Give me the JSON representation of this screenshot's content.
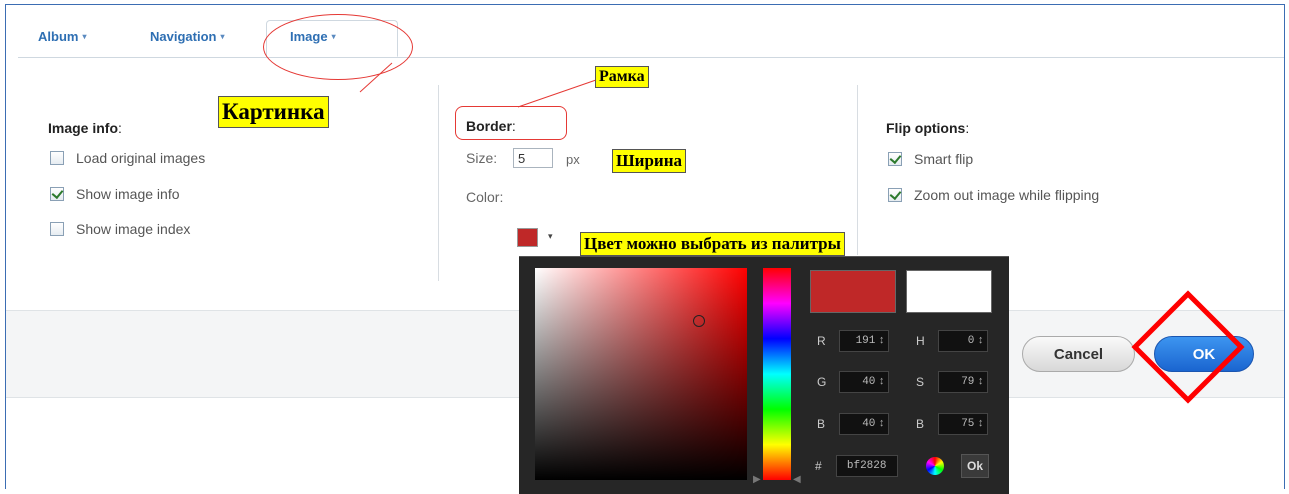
{
  "tabs": [
    {
      "label": "Album"
    },
    {
      "label": "Navigation"
    },
    {
      "label": "Image"
    }
  ],
  "image_info": {
    "title": "Image info",
    "options": [
      {
        "label": "Load original images",
        "checked": false
      },
      {
        "label": "Show image info",
        "checked": true
      },
      {
        "label": "Show image index",
        "checked": false
      }
    ]
  },
  "border": {
    "title": "Border",
    "size_label": "Size:",
    "size_value": "5",
    "size_unit": "px",
    "color_label": "Color:",
    "color_value": "#bf2828"
  },
  "flip": {
    "title": "Flip options",
    "options": [
      {
        "label": "Smart flip",
        "checked": true
      },
      {
        "label": "Zoom out image while flipping",
        "checked": true
      }
    ]
  },
  "annotations": {
    "image_tab": "Картинка",
    "frame": "Рамка",
    "width": "Ширина",
    "palette": "Цвет можно выбрать из палитры"
  },
  "picker": {
    "r": {
      "label": "R",
      "value": "191"
    },
    "g": {
      "label": "G",
      "value": "40"
    },
    "b": {
      "label": "B",
      "value": "40"
    },
    "h": {
      "label": "H",
      "value": "0"
    },
    "s": {
      "label": "S",
      "value": "79"
    },
    "v": {
      "label": "B",
      "value": "75"
    },
    "hex_label": "#",
    "hex_value": "bf2828",
    "ok_label": "Ok",
    "spin_glyph": "↕",
    "new_color": "#bf2828",
    "old_color": "#ffffff"
  },
  "buttons": {
    "cancel": "Cancel",
    "ok": "OK"
  },
  "icons": {
    "caret": "▾",
    "color_wheel": "color-wheel-icon"
  },
  "colors": {
    "tab_text": "#2e6fb3",
    "annotation_bg": "#ffff00",
    "annotation_stroke": "#e53935",
    "ok_button": "#1a65d0"
  }
}
